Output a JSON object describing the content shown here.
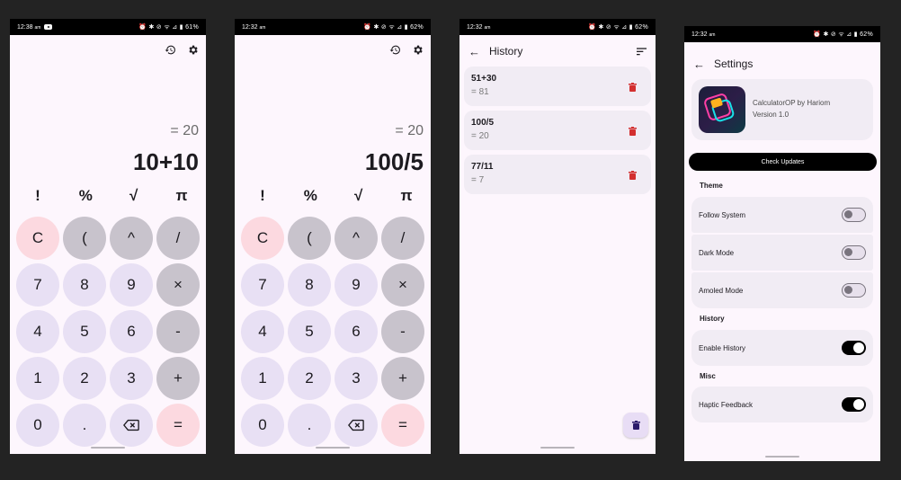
{
  "calc1": {
    "status": {
      "time": "12:38",
      "ampm": "am",
      "right": "⏰ ✱ ⊘ ᯤ ⊿ ▮ 61%"
    },
    "result": "= 20",
    "expression": "10+10"
  },
  "calc2": {
    "status": {
      "time": "12:32",
      "ampm": "am",
      "right": "⏰ ✱ ⊘ ᯤ ⊿ ▮ 62%"
    },
    "result": "= 20",
    "expression": "100/5"
  },
  "functions": [
    "!",
    "%",
    "√",
    "π"
  ],
  "keys": [
    {
      "label": "C",
      "style": "pink",
      "name": "clear-key"
    },
    {
      "label": "(",
      "style": "op",
      "name": "open-paren-key"
    },
    {
      "label": "^",
      "style": "op",
      "name": "power-key"
    },
    {
      "label": "/",
      "style": "op",
      "name": "divide-key"
    },
    {
      "label": "7",
      "style": "num",
      "name": "digit-7-key"
    },
    {
      "label": "8",
      "style": "num",
      "name": "digit-8-key"
    },
    {
      "label": "9",
      "style": "num",
      "name": "digit-9-key"
    },
    {
      "label": "×",
      "style": "op",
      "name": "multiply-key"
    },
    {
      "label": "4",
      "style": "num",
      "name": "digit-4-key"
    },
    {
      "label": "5",
      "style": "num",
      "name": "digit-5-key"
    },
    {
      "label": "6",
      "style": "num",
      "name": "digit-6-key"
    },
    {
      "label": "-",
      "style": "op",
      "name": "minus-key"
    },
    {
      "label": "1",
      "style": "num",
      "name": "digit-1-key"
    },
    {
      "label": "2",
      "style": "num",
      "name": "digit-2-key"
    },
    {
      "label": "3",
      "style": "num",
      "name": "digit-3-key"
    },
    {
      "label": "+",
      "style": "op",
      "name": "plus-key"
    },
    {
      "label": "0",
      "style": "num",
      "name": "digit-0-key"
    },
    {
      "label": ".",
      "style": "num",
      "name": "decimal-key"
    },
    {
      "label": "",
      "style": "num",
      "name": "backspace-key",
      "icon": "backspace-icon"
    },
    {
      "label": "=",
      "style": "pink",
      "name": "equals-key"
    }
  ],
  "history": {
    "status": {
      "time": "12:32",
      "ampm": "am",
      "right": "⏰ ✱ ⊘ ᯤ ⊿ ▮ 62%"
    },
    "title": "History",
    "items": [
      {
        "expr": "51+30",
        "result": "= 81"
      },
      {
        "expr": "100/5",
        "result": "= 20"
      },
      {
        "expr": "77/11",
        "result": "= 7"
      }
    ]
  },
  "settings": {
    "status": {
      "time": "12:32",
      "ampm": "am",
      "right": "⏰ ✱ ⊘ ᯤ ⊿ ▮ 62%"
    },
    "title": "Settings",
    "app_name": "CalculatorOP by Hariom",
    "version": "Version 1.0",
    "check_updates": "Check Updates",
    "sections": {
      "theme": "Theme",
      "history": "History",
      "misc": "Misc"
    },
    "rows": {
      "follow_system": "Follow System",
      "dark_mode": "Dark Mode",
      "amoled_mode": "Amoled Mode",
      "enable_history": "Enable History",
      "haptic_feedback": "Haptic Feedback"
    },
    "toggle_states": {
      "follow_system": false,
      "dark_mode": false,
      "amoled_mode": false,
      "enable_history": true,
      "haptic_feedback": true
    }
  },
  "colors": {
    "background": "#232323",
    "screen": "#fdf6fd",
    "key_num": "#e8e0f4",
    "key_op": "#c8c3cc",
    "key_accent": "#fcd9e0",
    "trash": "#d32f2f"
  }
}
